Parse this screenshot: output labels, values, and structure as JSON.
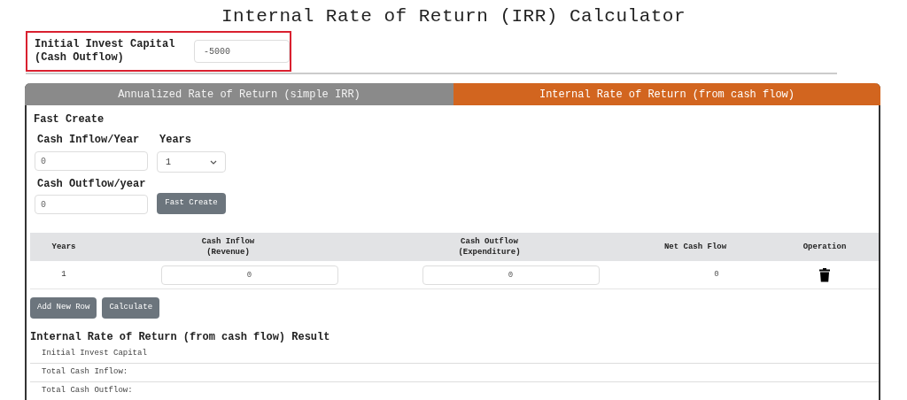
{
  "title": "Internal Rate of Return (IRR) Calculator",
  "initial_capital": {
    "label": "Initial Invest Capital (Cash Outflow)",
    "value": "-5000"
  },
  "tabs": [
    {
      "label": "Annualized Rate of Return (simple IRR)",
      "selected": false
    },
    {
      "label": "Internal Rate of Return (from cash flow)",
      "selected": true
    }
  ],
  "fast_create": {
    "heading": "Fast Create",
    "inflow_label": "Cash Inflow/Year",
    "inflow_value": "0",
    "years_label": "Years",
    "years_value": "1",
    "outflow_label": "Cash Outflow/year",
    "outflow_value": "0",
    "button": "Fast Create"
  },
  "table": {
    "columns": [
      {
        "title": "Years"
      },
      {
        "title": "Cash Inflow",
        "subtitle": "(Revenue)"
      },
      {
        "title": "Cash Outflow",
        "subtitle": "(Expenditure)"
      },
      {
        "title": "Net Cash Flow"
      },
      {
        "title": "Operation"
      }
    ],
    "rows": [
      {
        "year": "1",
        "inflow": "0",
        "outflow": "0",
        "net": "0"
      }
    ]
  },
  "buttons": [
    "Add New Row",
    "Calculate"
  ],
  "result": {
    "heading": "Internal Rate of Return (from cash flow) Result",
    "rows": [
      "Initial Invest Capital",
      "Total Cash Inflow:",
      "Total Cash Outflow:"
    ]
  }
}
